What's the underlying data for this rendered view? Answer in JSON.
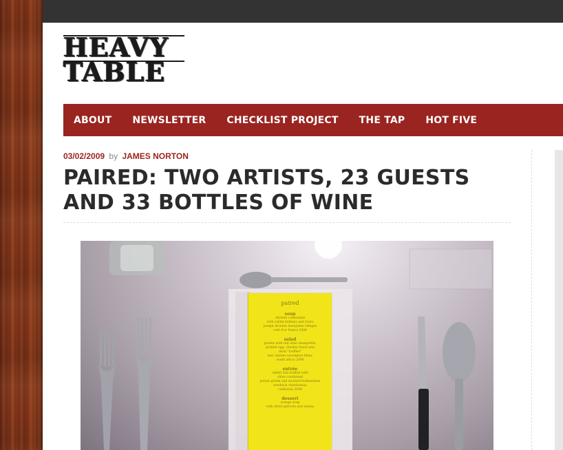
{
  "site": {
    "logo_line1": "HEAVY",
    "logo_line2": "TABLE"
  },
  "nav": {
    "items": [
      {
        "label": "ABOUT"
      },
      {
        "label": "NEWSLETTER"
      },
      {
        "label": "CHECKLIST PROJECT"
      },
      {
        "label": "THE TAP"
      },
      {
        "label": "HOT FIVE"
      }
    ]
  },
  "post": {
    "date": "03/02/2009",
    "by": "by",
    "author": "JAMES NORTON",
    "title": "PAIRED: TWO ARTISTS, 23 GUESTS AND 33 BOTTLES OF WINE"
  },
  "menu_card": {
    "title": "paired",
    "sections": [
      {
        "heading": "soup",
        "lines": [
          "chicken consommé",
          "with rabbit kidneys and livers",
          "joseph drouhin beaujolais villages",
          "coté d'or france 2008"
        ]
      },
      {
        "heading": "salad",
        "lines": [
          "greens with red wine vinaigrette,",
          "pickled egg, chicken livers and",
          "duck \"truffles\"",
          "mac staines sauvignon blanc",
          "south africa 2008"
        ]
      },
      {
        "heading": "entrée",
        "lines": [
          "rabbit loin stuffed with",
          "chive cornbread",
          "potato gratin and mustard hollandaise",
          "newback chardonnay",
          "california 2008"
        ]
      },
      {
        "heading": "dessert",
        "lines": [
          "orange soup",
          "with dried apricots and raisins"
        ]
      }
    ]
  },
  "colors": {
    "brand_red": "#9a2420",
    "title_text": "#2b2b2b",
    "top_bar": "#333333"
  }
}
